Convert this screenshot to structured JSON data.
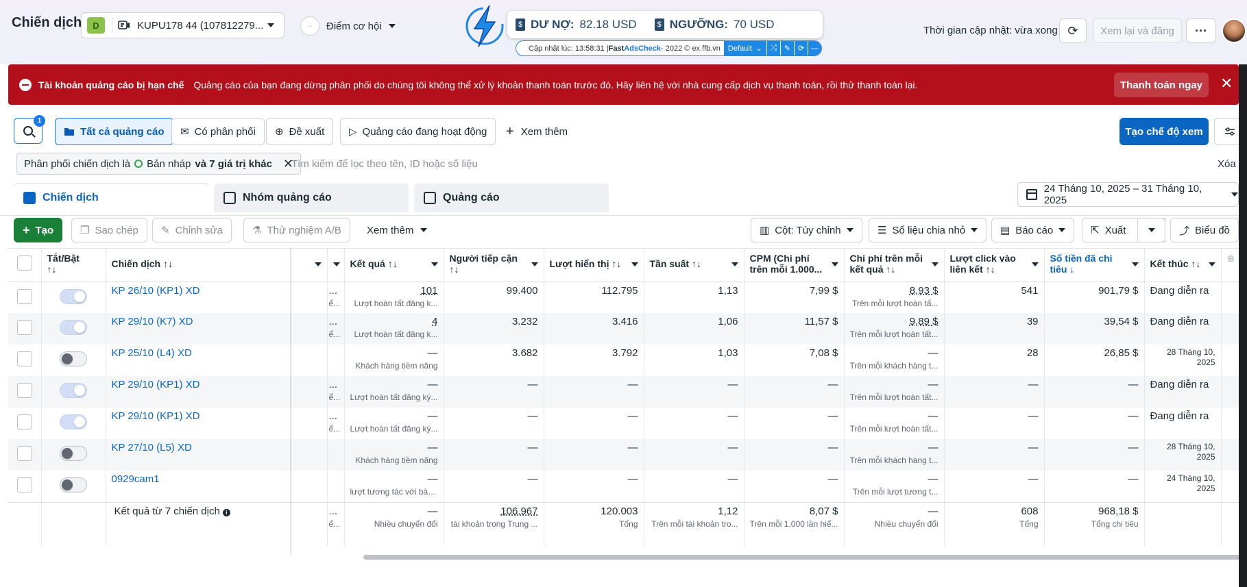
{
  "header": {
    "title": "Chiến dịch",
    "account_badge": "D",
    "account_label": "KUPU178 44 (107812279...",
    "opportunity_circle": "··",
    "opportunity_label": "Điểm cơ hội",
    "update_time": "Thời gian cập nhật: vừa xong",
    "review_label": "Xem lại và đăng",
    "more_label": "···"
  },
  "extension": {
    "debt_label": "DƯ NỢ:",
    "debt_value": "82.18 USD",
    "threshold_label": "NGƯỠNG:",
    "threshold_value": "70 USD",
    "updated_prefix": "Cập nhật lúc: 13:58:31 | ",
    "brand_fast": "Fast ",
    "brand_ads": "AdsCheck",
    "brand_suffix": " - 2022 © ex.ffb.vn",
    "default_label": "Default"
  },
  "alert": {
    "title": "Tài khoản quảng cáo bị hạn chế",
    "message": "Quảng cáo của bạn đang dừng phân phối do chúng tôi không thể xử lý khoản thanh toán trước đó. Hãy liên hệ với nhà cung cấp dịch vụ thanh toán, rồi thử thanh toán lại.",
    "pay_label": "Thanh toán ngay"
  },
  "filters": {
    "badge_count": "1",
    "all_ads": "Tất cả quảng cáo",
    "delivering": "Có phân phối",
    "suggested": "Đề xuất",
    "active_ads": "Quảng cáo đang hoạt động",
    "see_more": "Xem thêm",
    "create_view": "Tạo chế độ xem"
  },
  "filter_chip": {
    "prefix": "Phân phối chiến dịch là",
    "value": "Bản nháp",
    "suffix": "và 7 giá trị khác",
    "search_placeholder": "Tìm kiếm để lọc theo tên, ID hoặc số liệu",
    "clear": "Xóa"
  },
  "tabs": {
    "campaigns": "Chiến dịch",
    "ad_sets": "Nhóm quảng cáo",
    "ads": "Quảng cáo",
    "date_range": "24 Tháng 10, 2025 – 31 Tháng 10, 2025"
  },
  "toolbar": {
    "create": "Tạo",
    "duplicate": "Sao chép",
    "edit": "Chỉnh sửa",
    "ab_test": "Thử nghiệm A/B",
    "see_more": "Xem thêm",
    "columns": "Cột: Tùy chỉnh",
    "breakdown": "Số liệu chia nhỏ",
    "reports": "Báo cáo",
    "export": "Xuất",
    "chart": "Biểu đồ"
  },
  "columns": {
    "toggle": "Tắt/Bật",
    "toggle_sort": "↑↓",
    "campaign": "Chiến dịch ↑↓",
    "results": "Kết quả ↑↓",
    "reach": "Người tiếp cận",
    "reach_sort": "↑↓",
    "impressions": "Lượt hiển thị ↑↓",
    "frequency": "Tần suất ↑↓",
    "cpm": "CPM (Chi phí trên mỗi 1.000...",
    "cost_per_result": "Chi phí trên mỗi kết quả ↑↓",
    "link_clicks": "Lượt click vào liên kết ↑↓",
    "amount_spent": "Số tiền đã chi tiêu ↓",
    "ends": "Kết thúc ↑↓"
  },
  "rows": [
    {
      "name": "KP 26/10 (KP1) XD",
      "on": true,
      "del": "...",
      "del_sub": "ể...",
      "results": "101",
      "results_sub": "Lượt hoàn tất đăng k...",
      "reach": "99.400",
      "impressions": "112.795",
      "frequency": "1,13",
      "cpm": "7,99 $",
      "cpr": "8,93 $",
      "cpr_sub": "Trên mỗi lượt hoàn tấ...",
      "clicks": "541",
      "spent": "901,79 $",
      "ends": "Đang diễn ra",
      "ends_small": false
    },
    {
      "name": "KP 29/10 (K7) XD",
      "on": true,
      "del": "...",
      "del_sub": "ể...",
      "results": "4",
      "results_sub": "Lượt hoàn tất đăng k...",
      "reach": "3.232",
      "impressions": "3.416",
      "frequency": "1,06",
      "cpm": "11,57 $",
      "cpr": "9,89 $",
      "cpr_sub": "Trên mỗi lượt hoàn tất...",
      "clicks": "39",
      "spent": "39,54 $",
      "ends": "Đang diễn ra",
      "ends_small": false
    },
    {
      "name": "KP 25/10 (L4) XD",
      "on": false,
      "del": "",
      "del_sub": "",
      "results": "—",
      "results_sub": "Khách hàng tiềm năng",
      "reach": "3.682",
      "impressions": "3.792",
      "frequency": "1,03",
      "cpm": "7,08 $",
      "cpr": "—",
      "cpr_sub": "Trên mỗi khách hàng t...",
      "clicks": "28",
      "spent": "26,85 $",
      "ends": "28 Tháng 10, 2025",
      "ends_small": true
    },
    {
      "name": "KP 29/10 (KP1) XD",
      "on": true,
      "del": "...",
      "del_sub": "ể...",
      "results": "—",
      "results_sub": "Lượt hoàn tất đăng ký...",
      "reach": "—",
      "impressions": "—",
      "frequency": "—",
      "cpm": "—",
      "cpr": "—",
      "cpr_sub": "Trên mỗi lượt hoàn tất...",
      "clicks": "—",
      "spent": "—",
      "ends": "Đang diễn ra",
      "ends_small": false
    },
    {
      "name": "KP 29/10 (KP1) XD",
      "on": true,
      "del": "...",
      "del_sub": "ể...",
      "results": "—",
      "results_sub": "Lượt hoàn tất đăng ký...",
      "reach": "—",
      "impressions": "—",
      "frequency": "—",
      "cpm": "—",
      "cpr": "—",
      "cpr_sub": "Trên mỗi lượt hoàn tất...",
      "clicks": "—",
      "spent": "—",
      "ends": "Đang diễn ra",
      "ends_small": false
    },
    {
      "name": "KP 27/10 (L5) XD",
      "on": false,
      "del": "",
      "del_sub": "",
      "results": "—",
      "results_sub": "Khách hàng tiềm năng",
      "reach": "—",
      "impressions": "—",
      "frequency": "—",
      "cpm": "—",
      "cpr": "—",
      "cpr_sub": "Trên mỗi khách hàng t...",
      "clicks": "—",
      "spent": "—",
      "ends": "28 Tháng 10, 2025",
      "ends_small": true
    },
    {
      "name": "0929cam1",
      "on": false,
      "del": "",
      "del_sub": "",
      "results": "—",
      "results_sub": "lượt tương tác với bài ...",
      "reach": "—",
      "impressions": "—",
      "frequency": "—",
      "cpm": "—",
      "cpr": "—",
      "cpr_sub": "Trên mỗi lượt tương t...",
      "clicks": "—",
      "spent": "—",
      "ends": "24 Tháng 10, 2025",
      "ends_small": true
    }
  ],
  "totals": {
    "label": "Kết quả từ 7 chiến dịch",
    "del": "...",
    "del_sub": "ể...",
    "results": "—",
    "results_sub": "Nhiều chuyển đổi",
    "reach": "106.967",
    "reach_sub": "tài khoản trong Trung ...",
    "impressions": "120.003",
    "impressions_sub": "Tổng",
    "frequency": "1,12",
    "frequency_sub": "Trên mỗi tài khoản tro...",
    "cpm": "8,07 $",
    "cpm_sub": "Trên mỗi 1.000 lần hiể...",
    "cpr": "—",
    "cpr_sub": "Nhiều chuyển đổi",
    "clicks": "608",
    "clicks_sub": "Tổng",
    "spent": "968,18 $",
    "spent_sub": "Tổng chi tiêu"
  }
}
